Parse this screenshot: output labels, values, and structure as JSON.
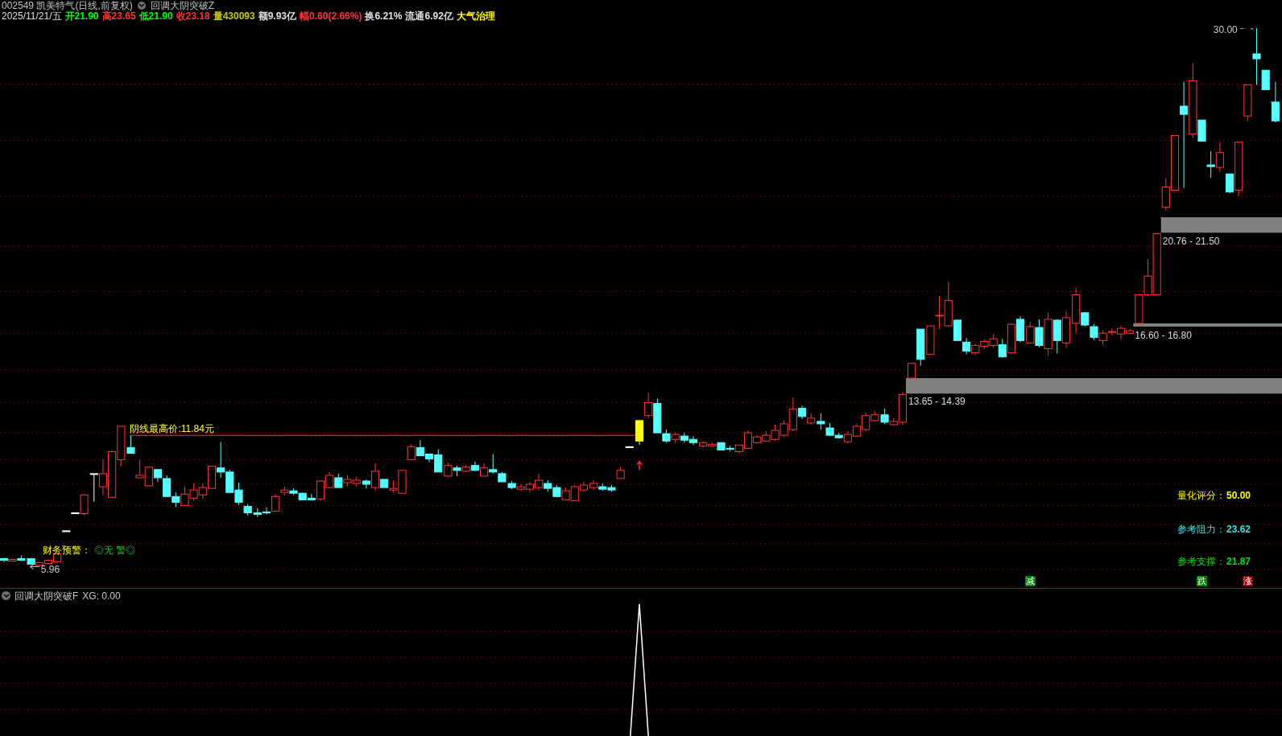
{
  "header": {
    "title": "002549 凯美特气(日线,前复权)",
    "indicator": "回调大阴突破Z"
  },
  "quote": {
    "date": "2025/11/21/五",
    "fields": [
      {
        "text": "开21.90",
        "color": "#00ff00"
      },
      {
        "text": "高23.65",
        "color": "#ff3232"
      },
      {
        "text": "低21.90",
        "color": "#00ff00"
      },
      {
        "text": "收23.18",
        "color": "#ff3232"
      },
      {
        "text": "量430093",
        "color": "#c8c800"
      },
      {
        "text": "额9.93亿",
        "color": "#e0e0e0"
      },
      {
        "text": "幅0.60(2.66%)",
        "color": "#ff3232"
      },
      {
        "text": "换6.21%",
        "color": "#e0e0e0"
      },
      {
        "text": "流通6.92亿",
        "color": "#e0e0e0"
      },
      {
        "text": "大气治理",
        "color": "#ffff00"
      }
    ]
  },
  "chart": {
    "max_label": "30.00",
    "min_label": "5.96",
    "resistance_label": "阴线最高价:11.84元",
    "zones": [
      {
        "label": "20.76 - 21.50"
      },
      {
        "label": "16.60 - 16.80"
      },
      {
        "label": "13.65 - 14.39"
      }
    ],
    "warning": {
      "label": "财务预警：",
      "value": "◎无 警◎"
    },
    "stats": [
      {
        "label": "量化评分：",
        "value": "50.00",
        "color": "#ffff00"
      },
      {
        "label": "参考阻力：",
        "value": "23.62",
        "color": "#40e0e0"
      },
      {
        "label": "参考支撑：",
        "value": "21.87",
        "color": "#00e000"
      }
    ],
    "badges": [
      {
        "text": "减",
        "color": "#008000"
      },
      {
        "text": "跌",
        "color": "#008000"
      },
      {
        "text": "涨",
        "color": "#900000"
      }
    ]
  },
  "indicator": {
    "name": "回调大阴突破F",
    "value": "XG: 0.00"
  }
}
